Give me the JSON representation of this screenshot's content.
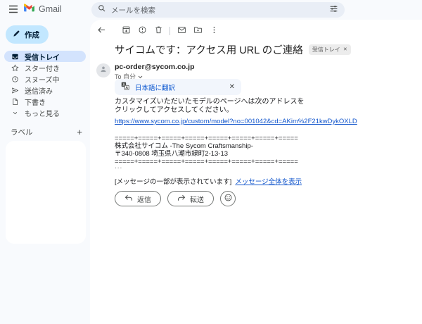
{
  "app": {
    "name": "Gmail"
  },
  "header": {
    "search": {
      "placeholder": "メールを検索"
    }
  },
  "sidebar": {
    "compose_label": "作成",
    "items": [
      {
        "label": "受信トレイ",
        "selected": true
      },
      {
        "label": "スター付き",
        "selected": false
      },
      {
        "label": "スヌーズ中",
        "selected": false
      },
      {
        "label": "送信済み",
        "selected": false
      },
      {
        "label": "下書き",
        "selected": false
      },
      {
        "label": "もっと見る",
        "selected": false
      }
    ],
    "labels_header": "ラベル",
    "labels_add": "+"
  },
  "email": {
    "subject": "サイコムです：アクセス用 URL のご連絡",
    "label_badge": "受信トレイ",
    "badge_close": "✕",
    "sender": "pc-order@sycom.co.jp",
    "recipient": "To 自分",
    "translate": {
      "label": "日本語に翻訳",
      "close": "✕"
    },
    "body": {
      "line1": "カスタマイズいただいたモデルのページへは次のアドレスを",
      "line2": "クリックしてアクセスしてください。",
      "link": "https://www.sycom.co.jp/custom/model?no=001042&cd=AKim%2F21kwDykOXLD",
      "separator1": "=====+=====+=====+=====+=====+=====+=====+=====",
      "signature_line1": "株式会社サイコム -The Sycom Craftsmanship-",
      "signature_line2": "〒340-0808 埼玉県八潮市緑町2-13-13",
      "separator2": "=====+=====+=====+=====+=====+=====+=====+=====",
      "trimmed_ellipsis": "...",
      "trimmed_note": "[メッセージの一部が表示されています]",
      "view_entire_link": "メッセージ全体を表示"
    },
    "actions": {
      "reply": "返信",
      "forward": "転送"
    }
  },
  "colors": {
    "app_bg": "#f8fafd",
    "compose_bg": "#c2e7ff",
    "selected_item_bg": "#d3e3fd",
    "search_bg": "#e9eef6",
    "translate_bg": "#f2f6fc",
    "accent_blue": "#0b57d0",
    "body_link_blue": "#1155cc",
    "badge_bg": "#ececec"
  }
}
